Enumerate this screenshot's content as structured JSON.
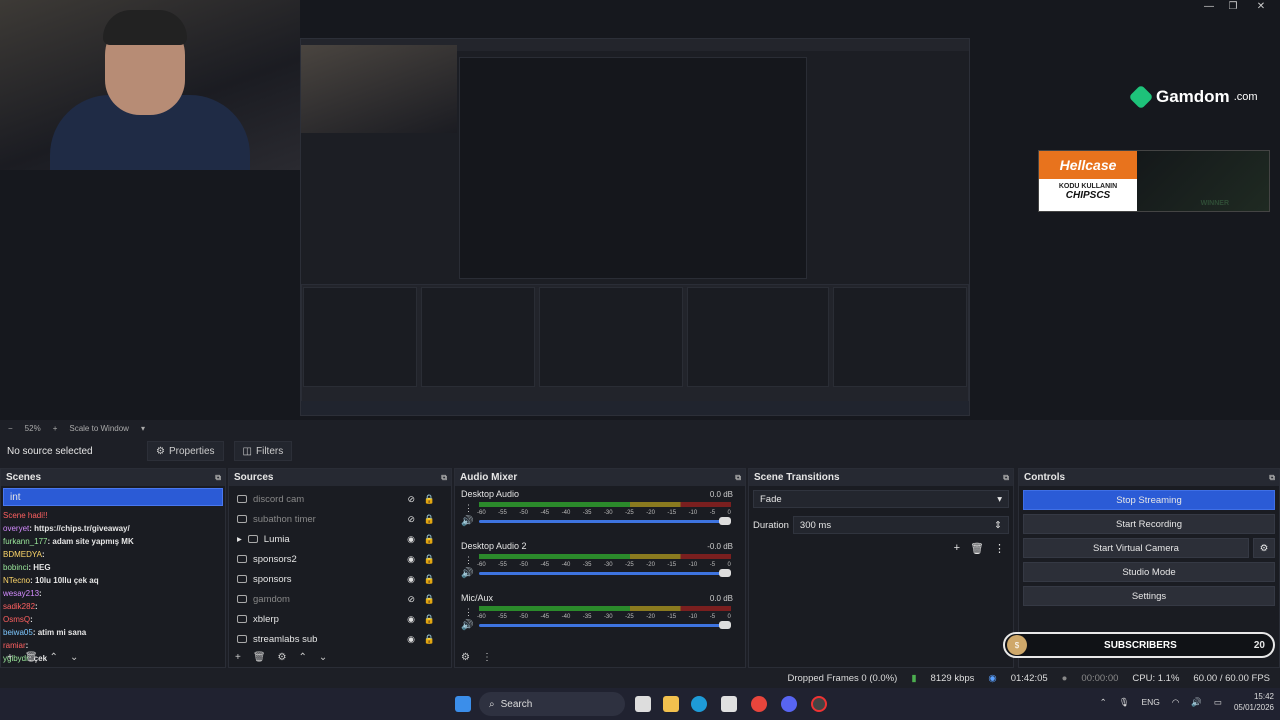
{
  "window": {
    "minimize": "—",
    "maximize": "❐",
    "close": "✕"
  },
  "overlay": {
    "gamdom_brand": "Gamdom",
    "gamdom_suffix": ".com",
    "hellcase_title": "Hellcase",
    "hellcase_line1": "KODU KULLANIN",
    "hellcase_code": "CHIPSCS",
    "hellcase_winner": "WINNER"
  },
  "zoom": {
    "minus": "−",
    "value": "52%",
    "plus": "+",
    "mode": "Scale to Window"
  },
  "propbar": {
    "selection": "No source selected",
    "properties": "Properties",
    "filters": "Filters"
  },
  "scenes": {
    "title": "Scenes",
    "selected": "int",
    "chat": [
      {
        "name": "Scene hadi!!",
        "text": "",
        "color": "nm1"
      },
      {
        "name": "overyet",
        "text": ": https://chips.tr/giveaway/",
        "color": "nm5"
      },
      {
        "name": "furkann_177",
        "text": ": adam site yapmış MK",
        "color": "nm3"
      },
      {
        "name": "BDMEDYA",
        "text": ":",
        "color": "nm4"
      },
      {
        "name": "bobinci",
        "text": ": HEG",
        "color": "nm3"
      },
      {
        "name": "NTecno",
        "text": ": 10lu 10llu çek aq",
        "color": "nm4"
      },
      {
        "name": "wesay213",
        "text": ":",
        "color": "nm5"
      },
      {
        "name": "sadik282",
        "text": ":",
        "color": "nm1"
      },
      {
        "name": "OsmsQ",
        "text": ":",
        "color": "nm1"
      },
      {
        "name": "beiwa05",
        "text": ": atim mi sana",
        "color": "nm2"
      },
      {
        "name": "ramiar",
        "text": ":",
        "color": "nm1"
      },
      {
        "name": "ygibydr",
        "text": ": çek",
        "color": "nm3"
      }
    ]
  },
  "sources": {
    "title": "Sources",
    "items": [
      {
        "label": "discord cam",
        "dim": true
      },
      {
        "label": "subathon timer",
        "dim": true
      },
      {
        "label": "Lumia",
        "dim": false
      },
      {
        "label": "sponsors2",
        "dim": false
      },
      {
        "label": "sponsors",
        "dim": false
      },
      {
        "label": "gamdom",
        "dim": true
      },
      {
        "label": "xblerp",
        "dim": false
      },
      {
        "label": "streamlabs sub",
        "dim": false
      }
    ]
  },
  "mixer": {
    "title": "Audio Mixer",
    "ticks": [
      "-60",
      "-55",
      "-50",
      "-45",
      "-40",
      "-35",
      "-30",
      "-25",
      "-20",
      "-15",
      "-10",
      "-5",
      "0"
    ],
    "channels": [
      {
        "name": "Desktop Audio",
        "db": "0.0 dB"
      },
      {
        "name": "Desktop Audio 2",
        "db": "-0.0 dB"
      },
      {
        "name": "Mic/Aux",
        "db": "0.0 dB"
      }
    ]
  },
  "transitions": {
    "title": "Scene Transitions",
    "selected": "Fade",
    "duration_label": "Duration",
    "duration_value": "300 ms"
  },
  "controls": {
    "title": "Controls",
    "stop_streaming": "Stop Streaming",
    "start_recording": "Start Recording",
    "start_virtual_camera": "Start Virtual Camera",
    "studio_mode": "Studio Mode",
    "settings": "Settings"
  },
  "subs": {
    "label": "SUBSCRIBERS",
    "count": "20"
  },
  "status": {
    "dropped": "Dropped Frames 0 (0.0%)",
    "kbps": "8129 kbps",
    "stream_time": "01:42:05",
    "rec_time": "00:00:00",
    "cpu": "CPU: 1.1%",
    "fps": "60.00 / 60.00 FPS"
  },
  "taskbar": {
    "search": "Search",
    "lang": "ENG",
    "time": "15:42",
    "date": "05/01/2026"
  },
  "colors": {
    "accent": "#2b5bd6",
    "meter_green": "#2b8a2b",
    "meter_yellow": "#8a7a1f",
    "meter_red": "#7a1f1f"
  }
}
